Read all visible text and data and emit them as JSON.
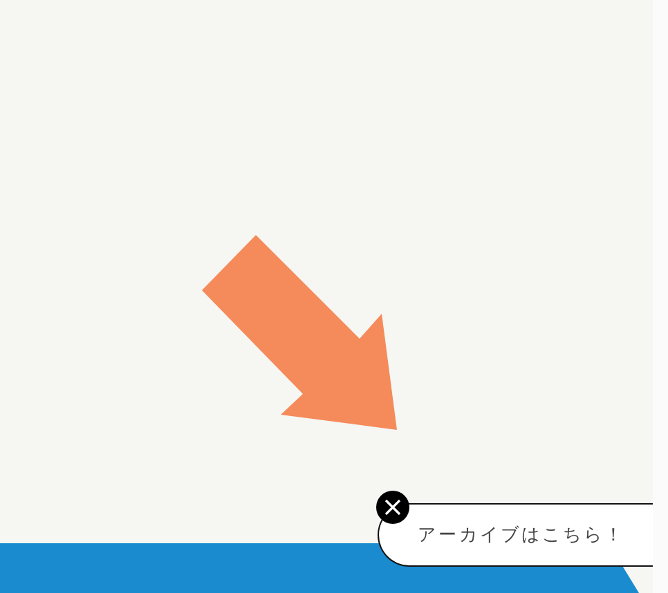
{
  "popup": {
    "text": "アーカイブはこちら！"
  }
}
